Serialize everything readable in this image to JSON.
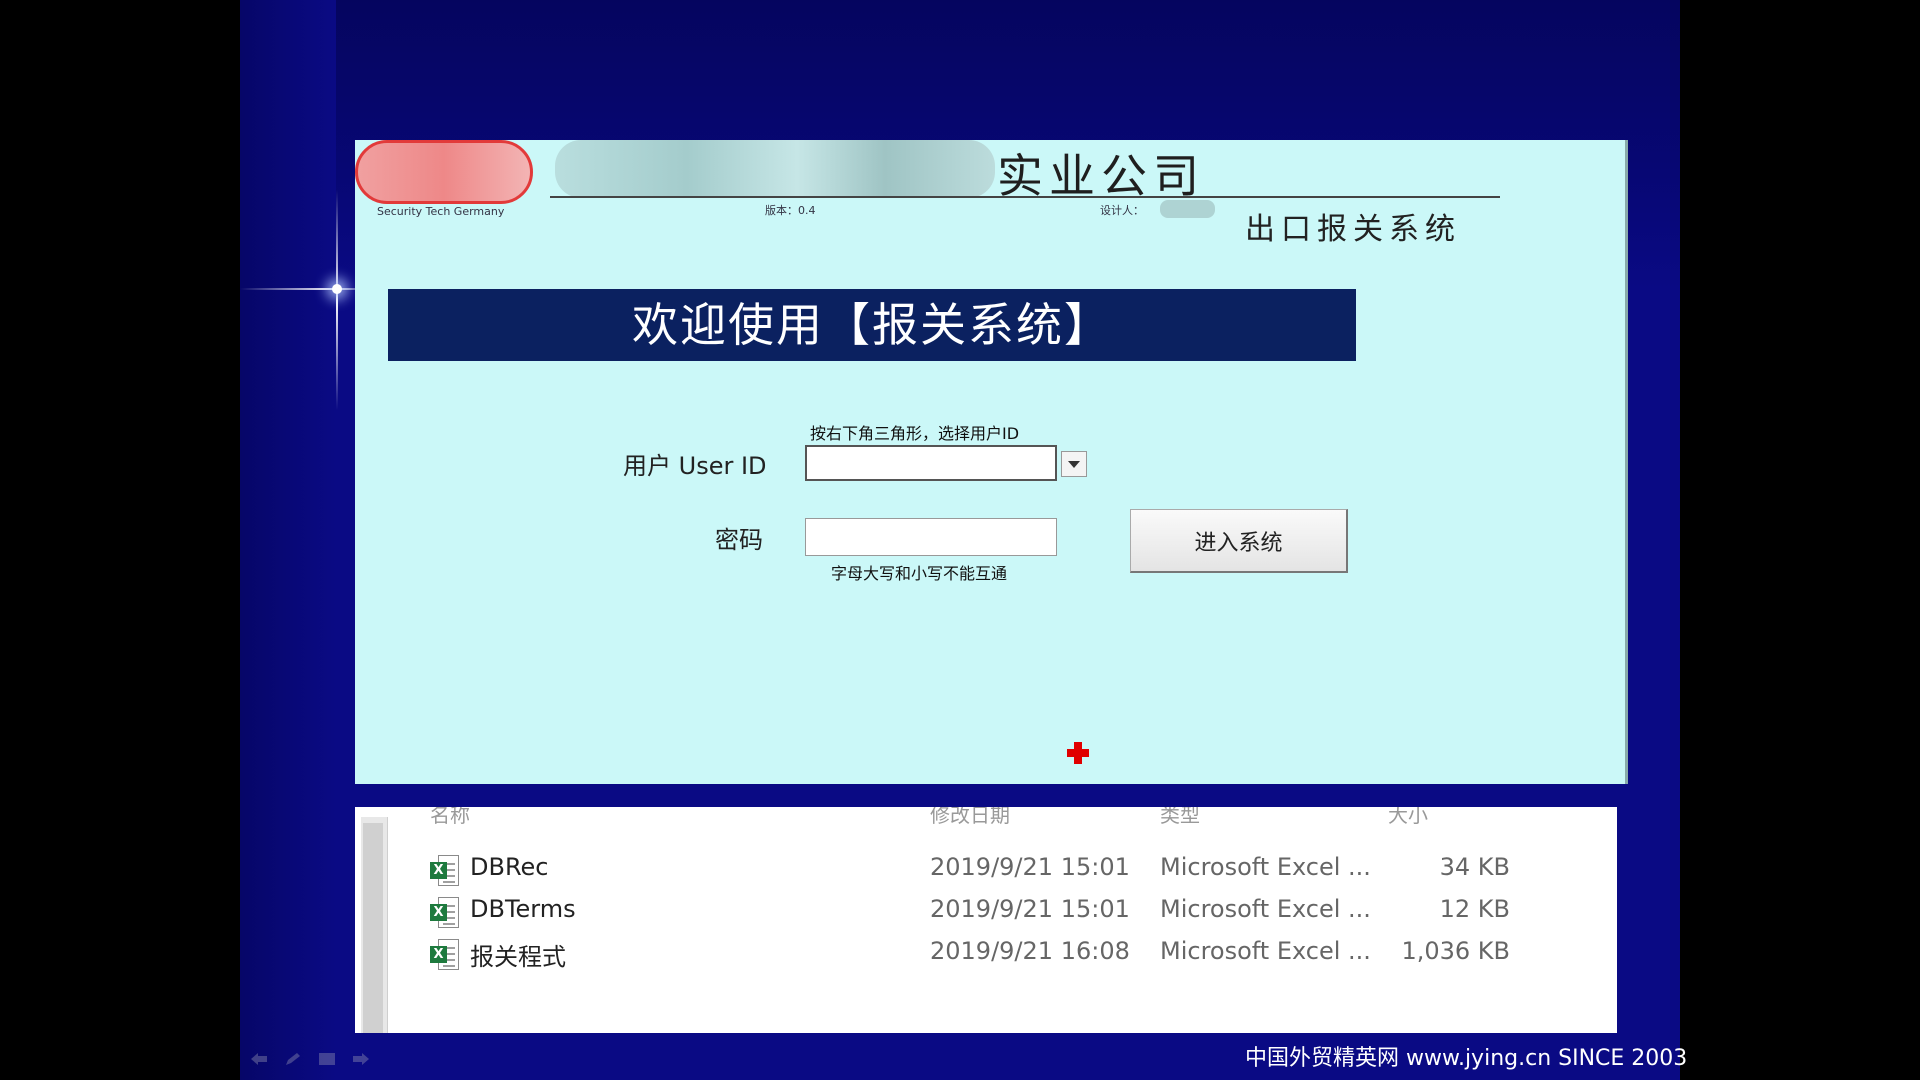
{
  "app": {
    "logo_subtitle": "Security Tech Germany",
    "company_suffix": "实业公司",
    "version_label": "版本：0.4",
    "designer_label": "设计人：",
    "system_subtitle": "出口报关系统",
    "welcome_banner": "欢迎使用【报关系统】"
  },
  "login": {
    "user_hint": "按右下角三角形，选择用户ID",
    "user_label": "用户 User ID",
    "user_value": "",
    "password_label": "密码",
    "password_value": "",
    "password_hint": "字母大写和小写不能互通",
    "enter_button": "进入系统"
  },
  "explorer": {
    "columns": [
      "名称",
      "修改日期",
      "类型",
      "大小"
    ],
    "files": [
      {
        "name": "DBRec",
        "modified": "2019/9/21 15:01",
        "type": "Microsoft Excel ...",
        "size": "34 KB"
      },
      {
        "name": "DBTerms",
        "modified": "2019/9/21 15:01",
        "type": "Microsoft Excel ...",
        "size": "12 KB"
      },
      {
        "name": "报关程式",
        "modified": "2019/9/21 16:08",
        "type": "Microsoft Excel ...",
        "size": "1,036 KB"
      }
    ]
  },
  "footer": {
    "watermark": "中国外贸精英网 www.jying.cn  SINCE 2003"
  },
  "colors": {
    "slide_background": "#0a0a84",
    "app_background": "#cbf8f8",
    "banner_background": "#0b2160",
    "excel_green": "#1e7a3e",
    "cursor_red": "#e00000"
  },
  "icons": {
    "file_icon": "excel-file-icon",
    "dropdown": "dropdown-triangle-icon",
    "cursor": "red-cross-cursor-icon"
  }
}
